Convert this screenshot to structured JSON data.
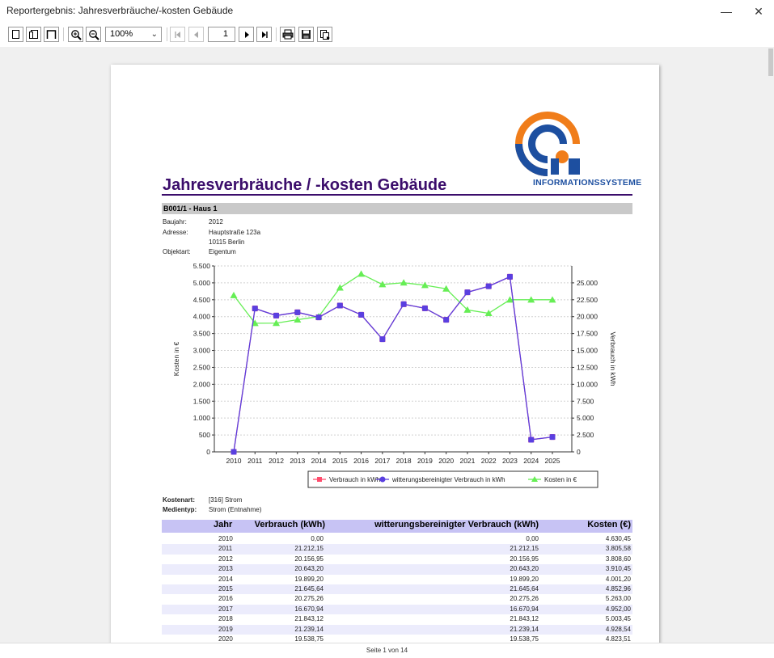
{
  "window": {
    "title": "Reportergebnis: Jahresverbräuche/-kosten Gebäude",
    "minimize": "—",
    "close": "✕"
  },
  "toolbar": {
    "zoom": "100%",
    "page": "1",
    "icons": [
      "single-page-icon",
      "two-page-icon",
      "full-page-icon",
      "zoom-in-icon",
      "zoom-out-icon",
      "first-page-icon",
      "prev-page-icon",
      "next-page-icon",
      "last-page-icon",
      "print-icon",
      "save-icon",
      "export-icon"
    ]
  },
  "status": {
    "text": "Seite 1 von 14"
  },
  "report": {
    "title": "Jahresverbräuche / -kosten Gebäude",
    "logo_text": "INFORMATIONSSYSTEME",
    "object": "B001/1 - Haus 1",
    "info": [
      {
        "label": "Baujahr:",
        "value": "2012"
      },
      {
        "label": "Adresse:",
        "value": "Hauptstraße 123a"
      },
      {
        "label": "",
        "value": "10115 Berlin"
      },
      {
        "label": "Objektart:",
        "value": "Eigentum"
      }
    ],
    "kostenart_label": "Kostenart:",
    "kostenart_value": "[316] Strom",
    "medientyp_label": "Medientyp:",
    "medientyp_value": "Strom (Entnahme)",
    "colors": {
      "title": "#3b0d6b",
      "header_bg": "#c7c3f4",
      "row_alt": "#ececfc",
      "series_verbrauch": "#ff4d6d",
      "series_witterung": "#5a3fe0",
      "series_kosten": "#66ee55"
    },
    "table": {
      "headers": [
        "Jahr",
        "Verbrauch (kWh)",
        "witterungsbereinigter Verbrauch (kWh)",
        "Kosten (€)"
      ],
      "rows": [
        [
          "2010",
          "0,00",
          "0,00",
          "4.630,45"
        ],
        [
          "2011",
          "21.212,15",
          "21.212,15",
          "3.805,58"
        ],
        [
          "2012",
          "20.156,95",
          "20.156,95",
          "3.808,60"
        ],
        [
          "2013",
          "20.643,20",
          "20.643,20",
          "3.910,45"
        ],
        [
          "2014",
          "19.899,20",
          "19.899,20",
          "4.001,20"
        ],
        [
          "2015",
          "21.645,64",
          "21.645,64",
          "4.852,96"
        ],
        [
          "2016",
          "20.275,26",
          "20.275,26",
          "5.263,00"
        ],
        [
          "2017",
          "16.670,94",
          "16.670,94",
          "4.952,00"
        ],
        [
          "2018",
          "21.843,12",
          "21.843,12",
          "5.003,45"
        ],
        [
          "2019",
          "21.239,14",
          "21.239,14",
          "4.928,54"
        ],
        [
          "2020",
          "19.538,75",
          "19.538,75",
          "4.823,51"
        ]
      ]
    }
  },
  "chart_data": {
    "type": "line",
    "x": [
      2010,
      2011,
      2012,
      2013,
      2014,
      2015,
      2016,
      2017,
      2018,
      2019,
      2020,
      2021,
      2022,
      2023,
      2024,
      2025
    ],
    "x_ticks": [
      "2010",
      "2011",
      "2012",
      "2013",
      "2014",
      "2015",
      "2016",
      "2017",
      "2018",
      "2019",
      "2020",
      "2021",
      "2022",
      "2023",
      "2024",
      "2025"
    ],
    "ylabel_left": "Kosten in €",
    "ylabel_right": "Verbrauch in kWh",
    "ylim_left": [
      0,
      5500
    ],
    "ylim_right": [
      0,
      27500
    ],
    "yticks_left": [
      "0",
      "500",
      "1.000",
      "1.500",
      "2.000",
      "2.500",
      "3.000",
      "3.500",
      "4.000",
      "4.500",
      "5.000",
      "5.500"
    ],
    "yticks_right": [
      "0",
      "2.500",
      "5.000",
      "7.500",
      "10.000",
      "12.500",
      "15.000",
      "17.500",
      "20.000",
      "22.500",
      "25.000"
    ],
    "grid": true,
    "legend_position": "bottom",
    "series": [
      {
        "name": "Verbrauch in kWh",
        "axis": "right",
        "marker": "square",
        "values": [
          0,
          21212.15,
          20156.95,
          20643.2,
          19899.2,
          21645.64,
          20275.26,
          16670.94,
          21843.12,
          21239.14,
          19538.75,
          23600,
          24500,
          25900,
          1800,
          2200
        ]
      },
      {
        "name": "witterungsbereinigter Verbrauch in kWh",
        "axis": "right",
        "marker": "circle",
        "values": [
          0,
          21212.15,
          20156.95,
          20643.2,
          19899.2,
          21645.64,
          20275.26,
          16670.94,
          21843.12,
          21239.14,
          19538.75,
          23600,
          24500,
          25900,
          1800,
          2200
        ]
      },
      {
        "name": "Kosten in €",
        "axis": "left",
        "marker": "triangle",
        "values": [
          4630.45,
          3805.58,
          3808.6,
          3910.45,
          4001.2,
          4852.96,
          5263,
          4952,
          5003.45,
          4928.54,
          4823.51,
          4200,
          4100,
          4500,
          4500,
          4500
        ]
      }
    ]
  }
}
